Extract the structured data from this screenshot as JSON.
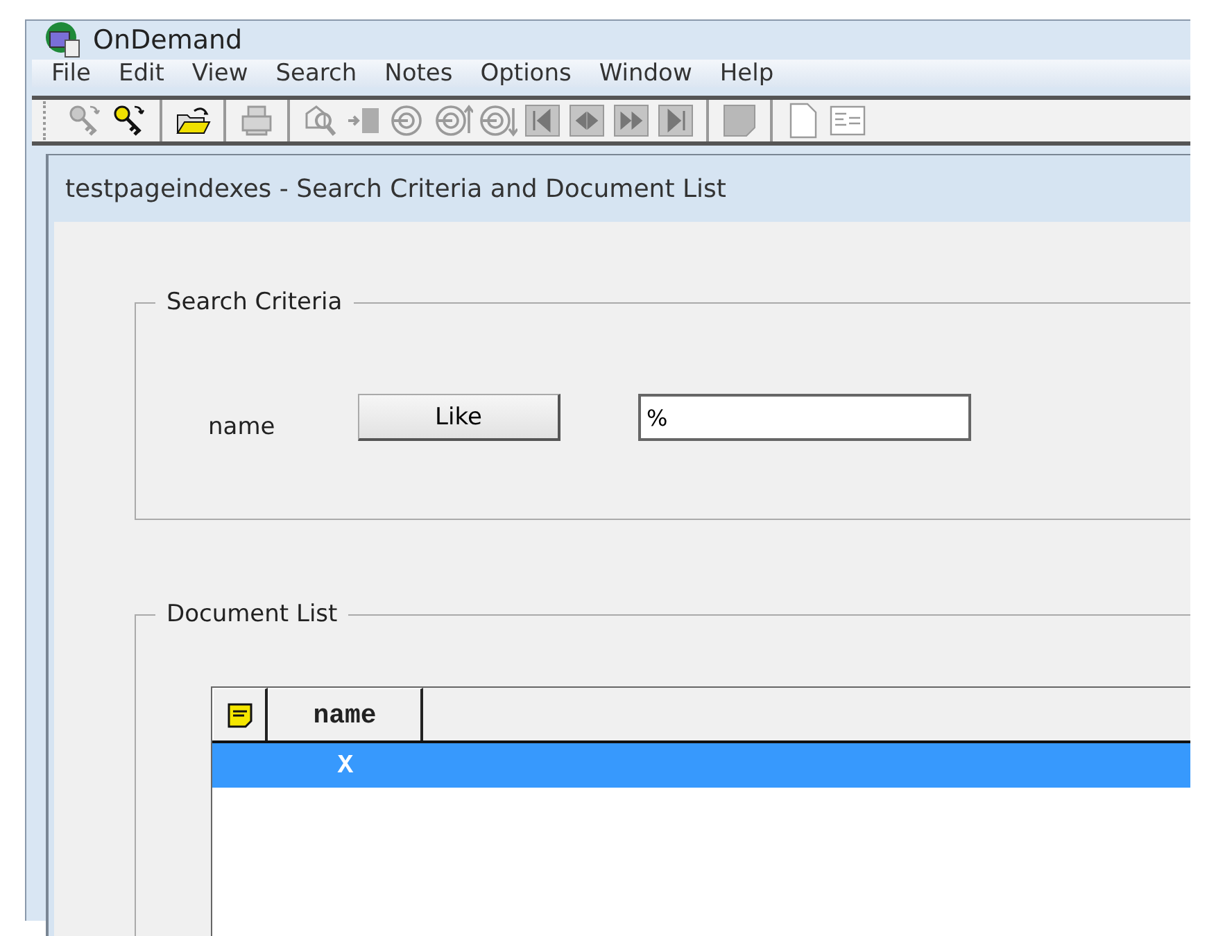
{
  "window": {
    "title": "OnDemand"
  },
  "menu": [
    "File",
    "Edit",
    "View",
    "Search",
    "Notes",
    "Options",
    "Window",
    "Help"
  ],
  "toolbar": [
    {
      "kind": "key",
      "disabled": true
    },
    {
      "kind": "key",
      "disabled": false
    },
    {
      "kind": "separator"
    },
    {
      "kind": "folder",
      "disabled": false
    },
    {
      "kind": "separator"
    },
    {
      "kind": "printer",
      "disabled": true
    },
    {
      "kind": "separator"
    },
    {
      "kind": "find",
      "disabled": true
    },
    {
      "kind": "insert",
      "disabled": true
    },
    {
      "kind": "target",
      "disabled": true
    },
    {
      "kind": "target-up",
      "disabled": true
    },
    {
      "kind": "target-down",
      "disabled": true
    },
    {
      "kind": "first",
      "disabled": true
    },
    {
      "kind": "prev",
      "disabled": true
    },
    {
      "kind": "next",
      "disabled": true
    },
    {
      "kind": "last",
      "disabled": true
    },
    {
      "kind": "separator"
    },
    {
      "kind": "grid",
      "disabled": true
    },
    {
      "kind": "separator"
    },
    {
      "kind": "page",
      "disabled": true
    },
    {
      "kind": "form",
      "disabled": true
    }
  ],
  "child_window": {
    "title": "testpageindexes - Search Criteria and Document List"
  },
  "search_criteria": {
    "title": "Search Criteria",
    "field_label": "name",
    "operator": "Like",
    "value": "%"
  },
  "document_list": {
    "title": "Document List",
    "columns": [
      {
        "kind": "note"
      },
      {
        "kind": "text",
        "label": "name"
      }
    ],
    "rows": [
      {
        "cells": [
          "X"
        ],
        "selected": true
      }
    ]
  }
}
